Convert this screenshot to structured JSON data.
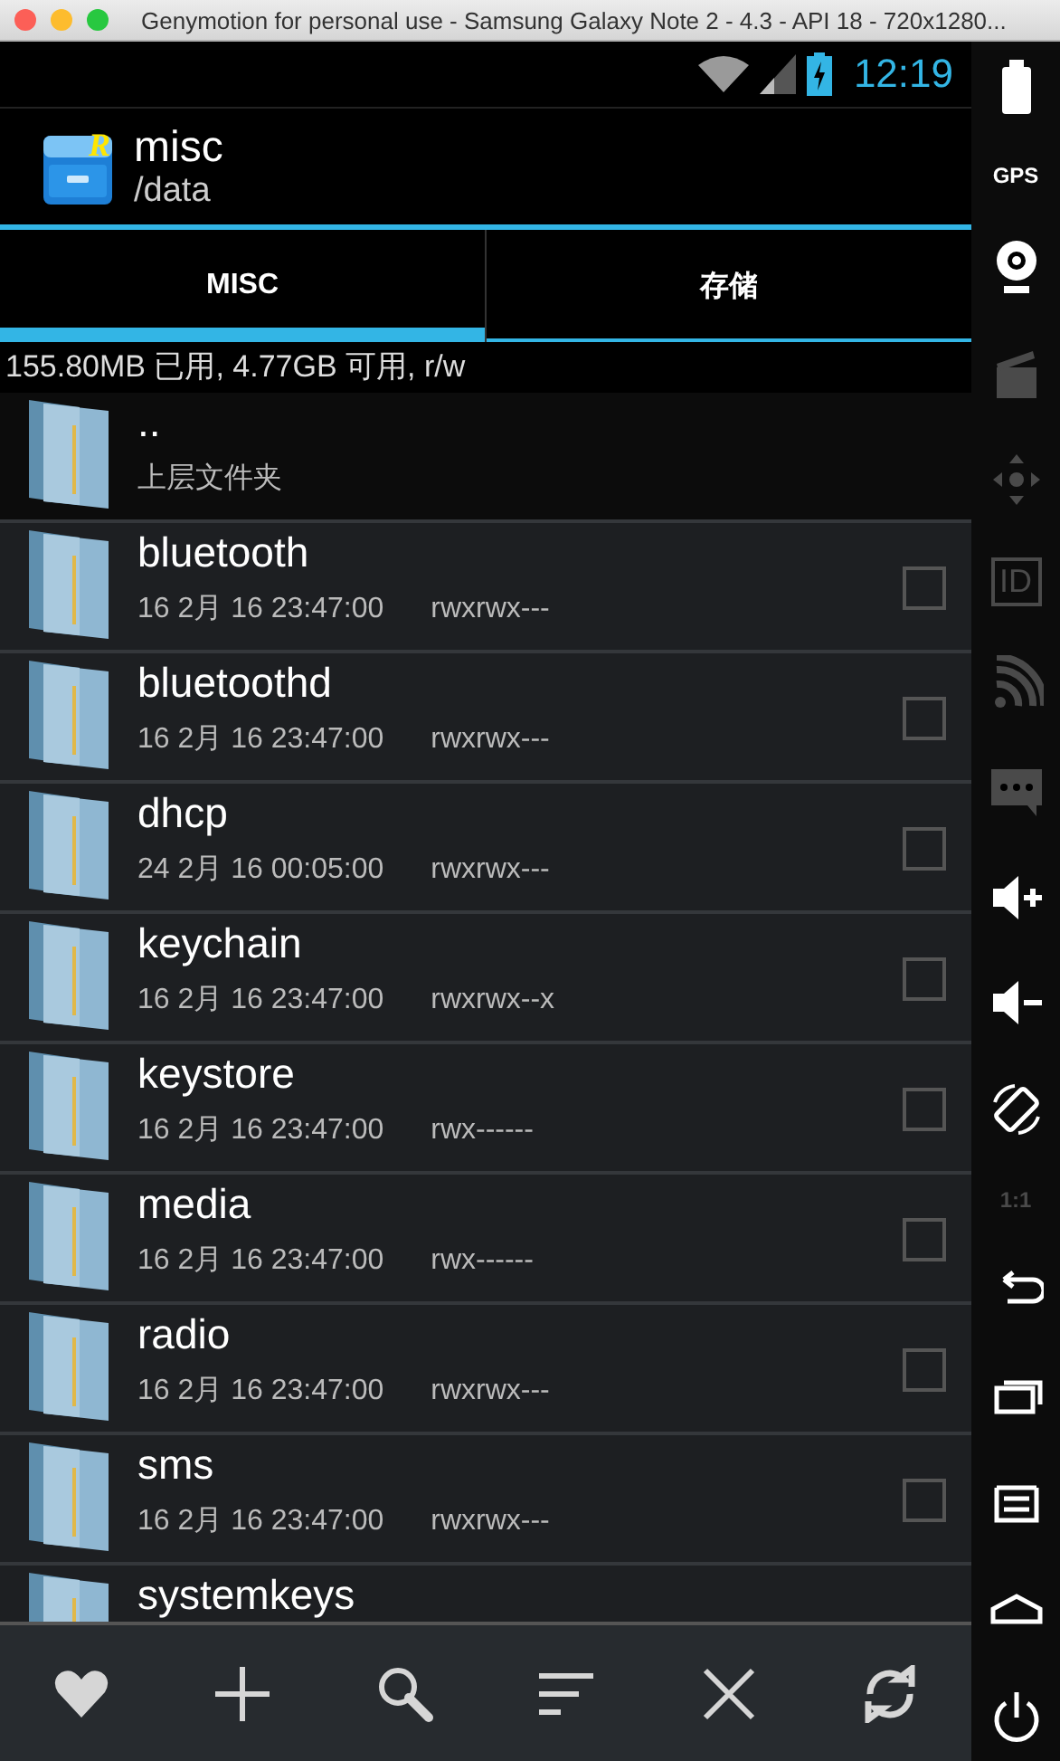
{
  "window": {
    "title": "Genymotion for personal use - Samsung Galaxy Note 2 - 4.3 - API 18 - 720x1280..."
  },
  "status_bar": {
    "time": "12:19"
  },
  "action_bar": {
    "logo_letter": "R",
    "title": "misc",
    "subtitle": "/data"
  },
  "tabs": [
    {
      "label": "MISC",
      "selected": true
    },
    {
      "label": "存储",
      "selected": false
    }
  ],
  "storage_info": "155.80MB 已用, 4.77GB 可用, r/w",
  "files": [
    {
      "kind": "parent",
      "name": "..",
      "detail": "上层文件夹"
    },
    {
      "kind": "folder",
      "name": "bluetooth",
      "date": "16 2月 16 23:47:00",
      "permissions": "rwxrwx---",
      "checked": false
    },
    {
      "kind": "folder",
      "name": "bluetoothd",
      "date": "16 2月 16 23:47:00",
      "permissions": "rwxrwx---",
      "checked": false
    },
    {
      "kind": "folder",
      "name": "dhcp",
      "date": "24 2月 16 00:05:00",
      "permissions": "rwxrwx---",
      "checked": false
    },
    {
      "kind": "folder",
      "name": "keychain",
      "date": "16 2月 16 23:47:00",
      "permissions": "rwxrwx--x",
      "checked": false
    },
    {
      "kind": "folder",
      "name": "keystore",
      "date": "16 2月 16 23:47:00",
      "permissions": "rwx------",
      "checked": false
    },
    {
      "kind": "folder",
      "name": "media",
      "date": "16 2月 16 23:47:00",
      "permissions": "rwx------",
      "checked": false
    },
    {
      "kind": "folder",
      "name": "radio",
      "date": "16 2月 16 23:47:00",
      "permissions": "rwxrwx---",
      "checked": false
    },
    {
      "kind": "folder",
      "name": "sms",
      "date": "16 2月 16 23:47:00",
      "permissions": "rwxrwx---",
      "checked": false
    },
    {
      "kind": "folder",
      "name": "systemkeys"
    }
  ],
  "toolbar": [
    {
      "kind": "heart"
    },
    {
      "kind": "plus"
    },
    {
      "kind": "search"
    },
    {
      "kind": "sort"
    },
    {
      "kind": "close"
    },
    {
      "kind": "refresh"
    }
  ],
  "sidebar": [
    {
      "kind": "battery",
      "disabled": false
    },
    {
      "kind": "gps",
      "label": "GPS",
      "disabled": false
    },
    {
      "kind": "webcam",
      "disabled": false
    },
    {
      "kind": "clapper",
      "disabled": true
    },
    {
      "kind": "dpad",
      "disabled": true
    },
    {
      "kind": "id",
      "label": "ID",
      "disabled": true
    },
    {
      "kind": "feed",
      "disabled": true
    },
    {
      "kind": "sms",
      "disabled": true
    },
    {
      "kind": "volume-up",
      "disabled": false
    },
    {
      "kind": "volume-down",
      "disabled": false
    },
    {
      "kind": "rotate",
      "disabled": false
    },
    {
      "kind": "scale",
      "label": "1:1",
      "disabled": true
    },
    {
      "kind": "back",
      "disabled": false
    },
    {
      "kind": "recent",
      "disabled": false
    },
    {
      "kind": "menu",
      "disabled": false
    },
    {
      "kind": "home",
      "disabled": false
    },
    {
      "kind": "power",
      "disabled": false
    }
  ]
}
